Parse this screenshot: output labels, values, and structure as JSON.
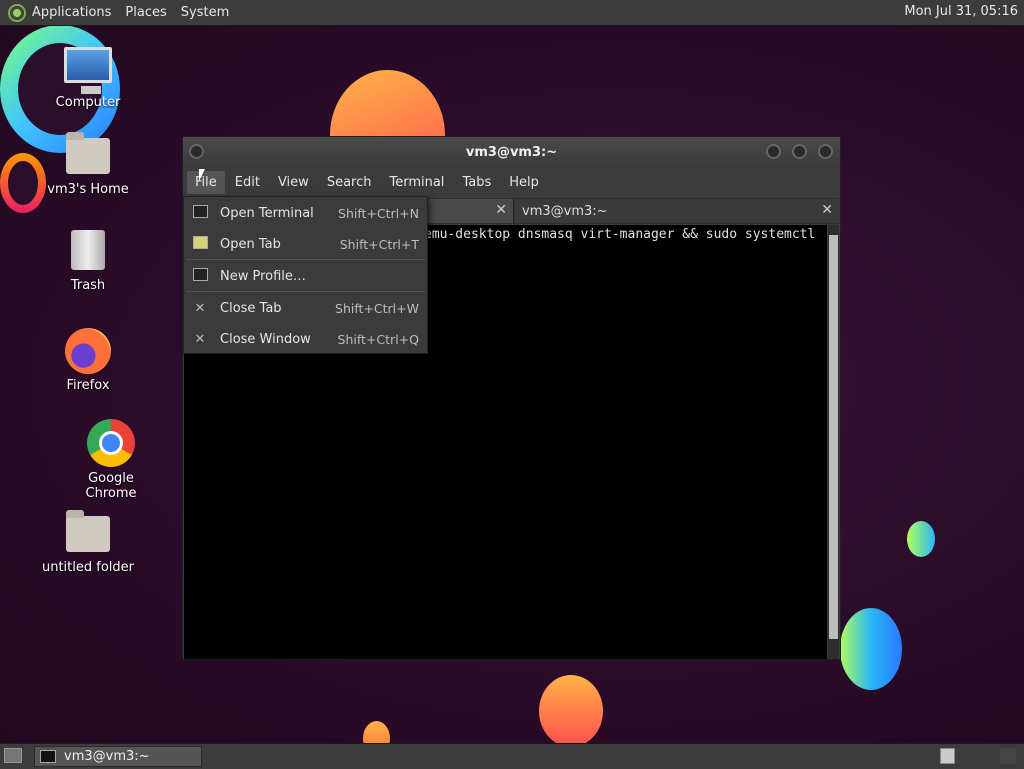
{
  "top_panel": {
    "menus": [
      "Applications",
      "Places",
      "System"
    ],
    "clock": "Mon Jul 31, 05:16"
  },
  "desktop_icons": [
    {
      "label": "Computer",
      "icon": "computer-icon"
    },
    {
      "label": "vm3's Home",
      "icon": "home-folder-icon"
    },
    {
      "label": "Trash",
      "icon": "trash-icon"
    },
    {
      "label": "Firefox",
      "icon": "firefox-icon"
    },
    {
      "label": "Google Chrome",
      "icon": "chrome-icon"
    },
    {
      "label": "untitled folder",
      "icon": "folder-icon"
    }
  ],
  "window": {
    "title": "vm3@vm3:~",
    "menubar": [
      "File",
      "Edit",
      "View",
      "Search",
      "Terminal",
      "Tabs",
      "Help"
    ],
    "tabs": [
      {
        "label": ""
      },
      {
        "label": "vm3@vm3:~"
      }
    ],
    "terminal_text": "emu-desktop dnsmasq virt-manager && sudo systemctl"
  },
  "file_menu": {
    "items": [
      {
        "label": "Open Terminal",
        "accel": "Shift+Ctrl+N",
        "icon": "terminal-icon"
      },
      {
        "label": "Open Tab",
        "accel": "Shift+Ctrl+T",
        "icon": "tab-icon"
      },
      {
        "label": "New Profile…",
        "accel": "",
        "icon": "profile-icon"
      },
      {
        "label": "Close Tab",
        "accel": "Shift+Ctrl+W",
        "icon": "close-icon"
      },
      {
        "label": "Close Window",
        "accel": "Shift+Ctrl+Q",
        "icon": "close-icon"
      }
    ]
  },
  "taskbar": {
    "window_button": "vm3@vm3:~"
  }
}
